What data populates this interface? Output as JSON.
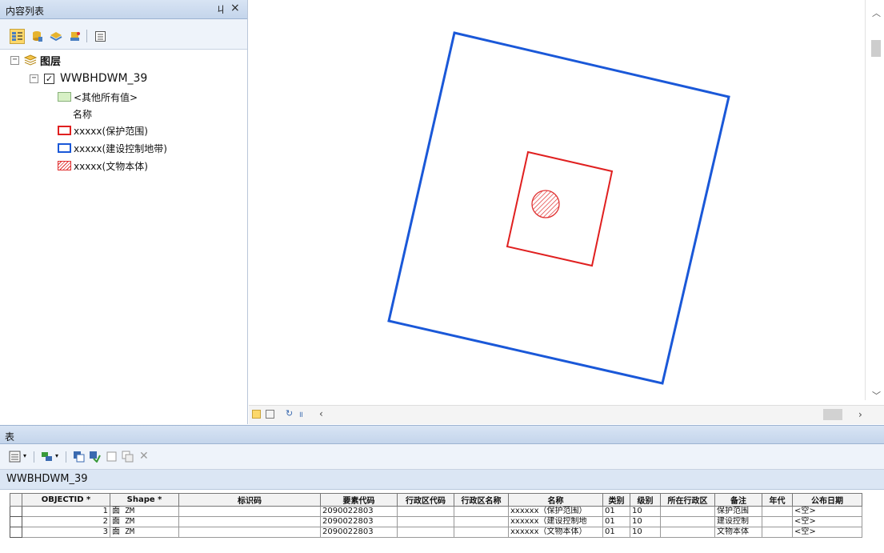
{
  "toc": {
    "title": "内容列表",
    "pin_glyph": "ㄐ",
    "close_glyph": "×",
    "toolbar_icons": [
      "list-by-drawing-order-icon",
      "list-by-source-icon",
      "list-by-visibility-icon",
      "list-by-selection-icon",
      "options-icon"
    ],
    "root_label": "图层",
    "layer_name": "WWBHDWM_39",
    "layer_checked": true,
    "legend": {
      "other_values": "<其他所有值>",
      "field_heading": "名称",
      "items": [
        {
          "label": "xxxxx(保护范围)",
          "symbol": "red-outline",
          "color": "#e02020"
        },
        {
          "label": "xxxxx(建设控制地带)",
          "symbol": "blue-outline",
          "color": "#1a58d8"
        },
        {
          "label": "xxxxx(文物本体)",
          "symbol": "red-hatch",
          "color": "#e03030"
        }
      ]
    }
  },
  "map": {
    "colors": {
      "protection": "#e02020",
      "control": "#1a58d8",
      "relic": "#e03030"
    }
  },
  "table_panel": {
    "title": "表",
    "layer_tab": "WWBHDWM_39",
    "columns": [
      "OBJECTID *",
      "Shape *",
      "标识码",
      "要素代码",
      "行政区代码",
      "行政区名称",
      "名称",
      "类别",
      "级别",
      "所在行政区",
      "备注",
      "年代",
      "公布日期"
    ],
    "rows": [
      [
        "1",
        "面 ZM",
        "",
        "2090022803",
        "",
        "",
        "xxxxxx（保护范围）",
        "01",
        "10",
        "",
        "保护范围",
        "",
        "<空>"
      ],
      [
        "2",
        "面 ZM",
        "",
        "2090022803",
        "",
        "",
        "xxxxxx（建设控制地",
        "01",
        "10",
        "",
        "建设控制",
        "",
        "<空>"
      ],
      [
        "3",
        "面 ZM",
        "",
        "2090022803",
        "",
        "",
        "xxxxxx（文物本体）",
        "01",
        "10",
        "",
        "文物本体",
        "",
        "<空>"
      ]
    ]
  }
}
